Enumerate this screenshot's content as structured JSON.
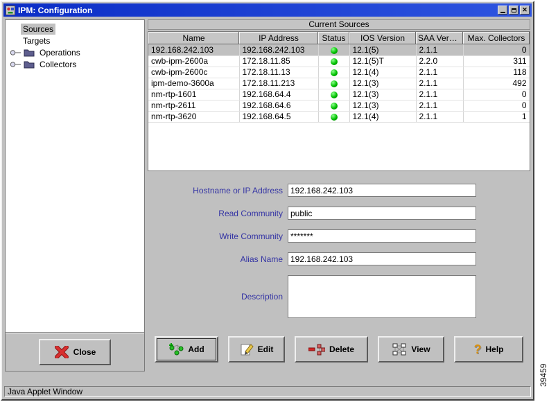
{
  "window": {
    "title": "IPM: Configuration",
    "controls": {
      "minimize": "minimize",
      "maximize": "maximize",
      "close": "✕"
    },
    "status_bar": "Java Applet Window"
  },
  "page": {
    "figure_number": "39459"
  },
  "colors": {
    "titlebar_blue": "#0b2dc6",
    "chrome_gray": "#c0c0c0",
    "form_label_blue": "#3434a4",
    "status_green": "#00b000",
    "selection_gray": "#c0c0c0"
  },
  "sidebar": {
    "items": [
      {
        "label": "Sources",
        "selected": true,
        "expandable": false
      },
      {
        "label": "Targets",
        "selected": false,
        "expandable": false
      },
      {
        "label": "Operations",
        "selected": false,
        "expandable": true
      },
      {
        "label": "Collectors",
        "selected": false,
        "expandable": true
      }
    ],
    "close_button": "Close"
  },
  "main": {
    "panel_title": "Current Sources",
    "table": {
      "columns": [
        "Name",
        "IP Address",
        "Status",
        "IOS Version",
        "SAA Versi...",
        "Max. Collectors"
      ],
      "rows": [
        {
          "name": "192.168.242.103",
          "ip_address": "192.168.242.103",
          "status": "green",
          "ios_version": "12.1(5)",
          "saa_version": "2.1.1",
          "max_collectors": "0",
          "selected": true
        },
        {
          "name": "cwb-ipm-2600a",
          "ip_address": "172.18.11.85",
          "status": "green",
          "ios_version": "12.1(5)T",
          "saa_version": "2.2.0",
          "max_collectors": "311",
          "selected": false
        },
        {
          "name": "cwb-ipm-2600c",
          "ip_address": "172.18.11.13",
          "status": "green",
          "ios_version": "12.1(4)",
          "saa_version": "2.1.1",
          "max_collectors": "118",
          "selected": false
        },
        {
          "name": "ipm-demo-3600a",
          "ip_address": "172.18.11.213",
          "status": "green",
          "ios_version": "12.1(3)",
          "saa_version": "2.1.1",
          "max_collectors": "492",
          "selected": false
        },
        {
          "name": "nm-rtp-1601",
          "ip_address": "192.168.64.4",
          "status": "green",
          "ios_version": "12.1(3)",
          "saa_version": "2.1.1",
          "max_collectors": "0",
          "selected": false
        },
        {
          "name": "nm-rtp-2611",
          "ip_address": "192.168.64.6",
          "status": "green",
          "ios_version": "12.1(3)",
          "saa_version": "2.1.1",
          "max_collectors": "0",
          "selected": false
        },
        {
          "name": "nm-rtp-3620",
          "ip_address": "192.168.64.5",
          "status": "green",
          "ios_version": "12.1(4)",
          "saa_version": "2.1.1",
          "max_collectors": "1",
          "selected": false
        }
      ]
    },
    "form": {
      "fields": [
        {
          "label": "Hostname or IP Address",
          "value": "192.168.242.103"
        },
        {
          "label": "Read Community",
          "value": "public"
        },
        {
          "label": "Write Community",
          "value": "*******"
        },
        {
          "label": "Alias Name",
          "value": "192.168.242.103"
        }
      ],
      "description": {
        "label": "Description",
        "value": ""
      }
    },
    "buttons": [
      {
        "label": "Add",
        "icon": "add-node-icon",
        "default": true
      },
      {
        "label": "Edit",
        "icon": "edit-pencil-icon"
      },
      {
        "label": "Delete",
        "icon": "delete-node-icon"
      },
      {
        "label": "View",
        "icon": "view-topology-icon"
      },
      {
        "label": "Help",
        "icon": "help-question-icon",
        "glyph": "?"
      }
    ]
  }
}
